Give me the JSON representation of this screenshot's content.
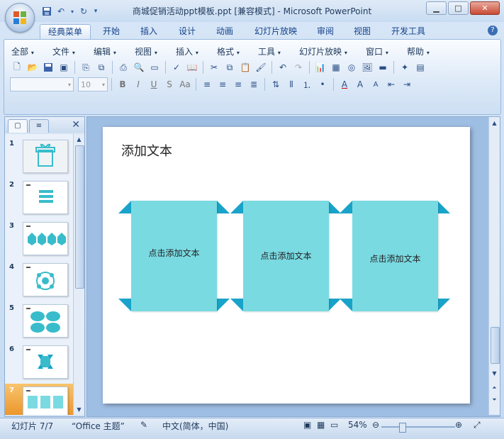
{
  "window": {
    "title": "商城促销活动ppt模板.ppt [兼容模式] - Microsoft PowerPoint"
  },
  "ribbon_tabs": [
    {
      "label": "经典菜单"
    },
    {
      "label": "开始"
    },
    {
      "label": "插入"
    },
    {
      "label": "设计"
    },
    {
      "label": "动画"
    },
    {
      "label": "幻灯片放映"
    },
    {
      "label": "审阅"
    },
    {
      "label": "视图"
    },
    {
      "label": "开发工具"
    }
  ],
  "menus": [
    {
      "label": "全部"
    },
    {
      "label": "文件"
    },
    {
      "label": "编辑"
    },
    {
      "label": "视图"
    },
    {
      "label": "插入"
    },
    {
      "label": "格式"
    },
    {
      "label": "工具"
    },
    {
      "label": "幻灯片放映"
    },
    {
      "label": "窗口"
    },
    {
      "label": "帮助"
    }
  ],
  "font_size_value": "10",
  "slides": [
    {
      "number": "1"
    },
    {
      "number": "2"
    },
    {
      "number": "3"
    },
    {
      "number": "4"
    },
    {
      "number": "5"
    },
    {
      "number": "6"
    },
    {
      "number": "7"
    }
  ],
  "current_slide": {
    "title": "添加文本",
    "cards": [
      {
        "text": "点击添加文本"
      },
      {
        "text": "点击添加文本"
      },
      {
        "text": "点击添加文本"
      }
    ]
  },
  "status_bar": {
    "slide_indicator": "幻灯片 7/7",
    "theme": "“Office 主题”",
    "language": "中文(简体，中国)",
    "zoom": "54%"
  },
  "colors": {
    "card_fill": "#7adae2",
    "corner_accent": "#1aa3c9",
    "selected_thumb": "#e98a1b"
  }
}
